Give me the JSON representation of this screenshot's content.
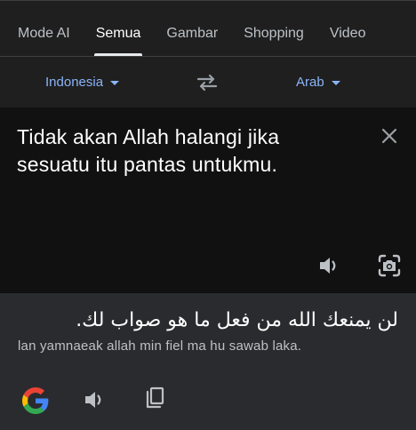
{
  "tabs": [
    "Mode AI",
    "Semua",
    "Gambar",
    "Shopping",
    "Video"
  ],
  "active_tab": "Semua",
  "language_bar": {
    "source_language": "Indonesia",
    "target_language": "Arab"
  },
  "source": {
    "text": "Tidak akan Allah halangi jika sesuatu itu pantas untukmu."
  },
  "translation": {
    "text": "لن يمنعك الله من فعل ما هو صواب لك.",
    "transliteration": "lan yamnaeak allah min fiel ma hu sawab laka."
  },
  "icons": {
    "swap": "swap-arrows-icon",
    "close": "close-icon",
    "source_speaker": "speaker-icon",
    "lens": "google-lens-icon",
    "google": "google-logo-icon",
    "target_speaker": "speaker-icon",
    "copy": "copy-icon"
  },
  "colors": {
    "accent": "#8ab4f8",
    "background": "#1f1f1f",
    "source_panel": "#111111",
    "target_panel": "#2a2b2e"
  }
}
